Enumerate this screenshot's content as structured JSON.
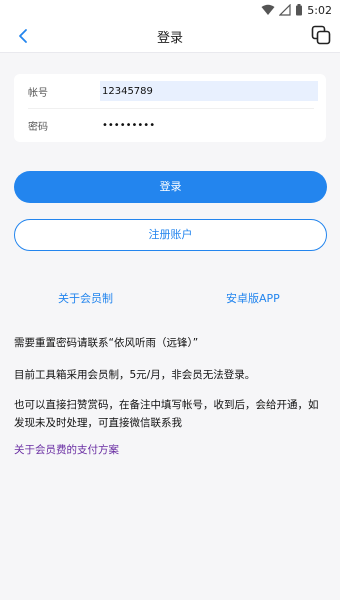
{
  "status_bar": {
    "time": "5:02",
    "icons": [
      "wifi-icon",
      "signal-icon",
      "battery-icon"
    ]
  },
  "nav": {
    "title": "登录",
    "back_icon": "chevron-left-icon",
    "right_icon": "copy-icon"
  },
  "form": {
    "account": {
      "label": "帐号",
      "value": "12345789"
    },
    "password": {
      "label": "密码",
      "value": "•••••••••"
    }
  },
  "buttons": {
    "login": "登录",
    "register": "注册账户"
  },
  "links": {
    "member": "关于会员制",
    "android": "安卓版APP",
    "payment": "关于会员费的支付方案"
  },
  "info": {
    "p1": "需要重置密码请联系“依风听雨（远锋）”",
    "p2": "目前工具箱采用会员制，5元/月，非会员无法登录。",
    "p3": "也可以直接扫赞赏码，在备注中填写帐号，收到后，会给开通，如发现未及时处理，可直接微信联系我"
  },
  "colors": {
    "accent": "#2385ee",
    "payment_link": "#6a2fa3",
    "background": "#f6f6f8"
  }
}
